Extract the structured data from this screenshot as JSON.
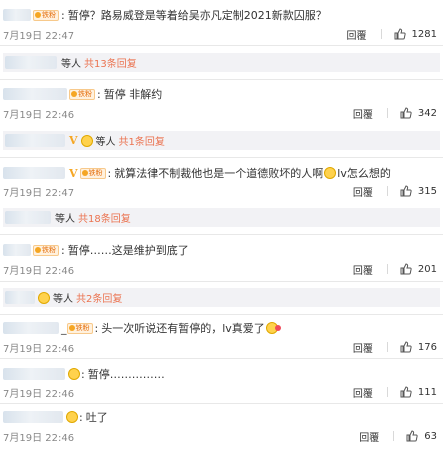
{
  "comments": [
    {
      "text": "暂停？路易威登是等着给吴亦凡定制2021新款囚服？",
      "time": "7月19日 22:47",
      "reply": "回覆",
      "likes": "1281",
      "badge": "铁粉"
    },
    {
      "text": "暂停 非解约",
      "time": "7月19日 22:46",
      "reply": "回覆",
      "likes": "342",
      "badge": "铁粉"
    },
    {
      "text": "就算法律不制裁他也是一个道德败坏的人啊",
      "text_after": "lv怎么想的",
      "time": "7月19日 22:47",
      "reply": "回覆",
      "likes": "315",
      "badge": "铁粉"
    },
    {
      "text": "暂停……这是维护到底了",
      "time": "7月19日 22:46",
      "reply": "回覆",
      "likes": "201",
      "badge": "铁粉"
    },
    {
      "text": "头一次听说还有暂停的，lv真爱了",
      "time": "7月19日 22:46",
      "reply": "回覆",
      "likes": "176",
      "badge": "铁粉",
      "lead": "_"
    },
    {
      "text": "暂停……………",
      "time": "7月19日 22:46",
      "reply": "回覆",
      "likes": "111"
    },
    {
      "text": "吐了",
      "time": "7月19日 22:46",
      "reply": "回覆",
      "likes": "63"
    }
  ],
  "sub_bars": [
    {
      "label": "等人",
      "link": "共13条回复"
    },
    {
      "label": "等人",
      "link": "共1条回复"
    },
    {
      "label": "等人",
      "link": "共18条回复"
    },
    {
      "label": "等人",
      "link": "共2条回复"
    }
  ],
  "icons": {
    "like": "thumbs-up-icon",
    "emoji": "smiley-face-icon",
    "fan_badge": "fan-badge-icon"
  },
  "colors": {
    "link": "#eb7350",
    "badge_bg": "#fff1de",
    "badge_text": "#e46d0a",
    "subbar_bg": "#f2f2f5"
  }
}
